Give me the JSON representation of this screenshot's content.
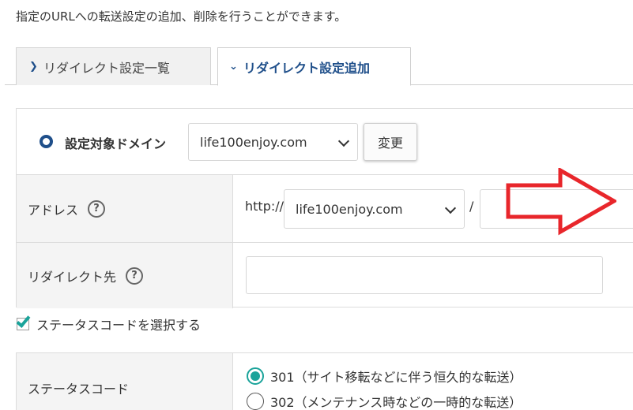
{
  "description": "指定のURLへの転送設定の追加、削除を行うことができます。",
  "tabs": [
    {
      "label": "リダイレクト設定一覧",
      "active": false
    },
    {
      "label": "リダイレクト設定追加",
      "active": true
    }
  ],
  "domain": {
    "label": "設定対象ドメイン",
    "selected": "life100enjoy.com",
    "change_label": "変更"
  },
  "address": {
    "label": "アドレス",
    "help": "?",
    "prefix": "http://",
    "selected_domain": "life100enjoy.com",
    "separator": "/",
    "path_value": ""
  },
  "redirect": {
    "label": "リダイレクト先",
    "help": "?",
    "value": ""
  },
  "status_toggle": {
    "label": "ステータスコードを選択する",
    "checked": true
  },
  "status_code": {
    "label": "ステータスコード",
    "options": [
      {
        "label": "301（サイト移転などに伴う恒久的な転送）",
        "selected": true
      },
      {
        "label": "302（メンテナンス時などの一時的な転送）",
        "selected": false
      }
    ]
  },
  "colors": {
    "accent_blue": "#1f4f8a",
    "accent_teal": "#1aa39a",
    "annotation_red": "#e8262b"
  },
  "icons": {
    "tab_list": "chevron-right-icon",
    "tab_add": "chevron-down-icon",
    "help": "help-icon",
    "annotation": "arrow-right-icon"
  }
}
